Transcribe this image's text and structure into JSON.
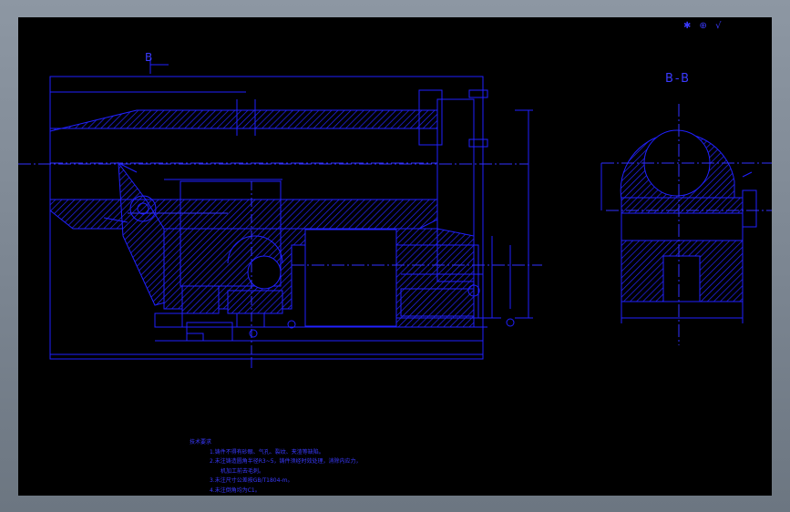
{
  "drawing": {
    "view_label_b": "B",
    "section_title": "B-B",
    "roughness_symbol": "✱ ⊕ √",
    "colors": {
      "background": "#000000",
      "line": "#2020ff",
      "center_line": "#3232ff",
      "text": "#3a3aff",
      "frame": "#7f8996"
    }
  },
  "notes": {
    "heading": "技术要求",
    "items": [
      "1.铸件不得有砂眼、气孔、裂纹、夹渣等缺陷。",
      "2.未注铸造圆角半径R3~5，铸件须经时效处理，消除内应力，",
      "机加工前去毛刺。",
      "3.未注尺寸公差按GB/T1804-m。",
      "4.未注倒角均为C1。"
    ]
  }
}
